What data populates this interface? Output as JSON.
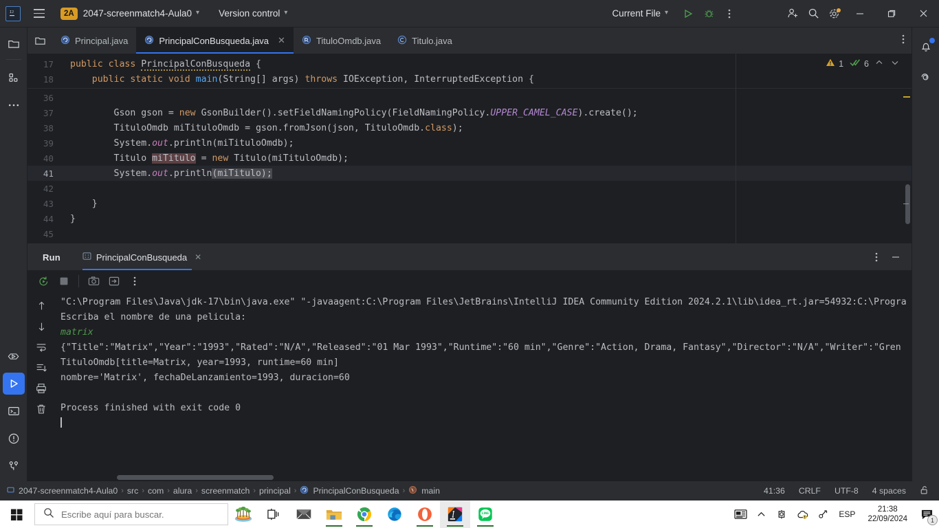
{
  "titlebar": {
    "project_badge": "2A",
    "project_name": "2047-screenmatch4-Aula0",
    "version_control": "Version control",
    "run_config": "Current File",
    "icons": {
      "menu": "hamburger-icon",
      "run": "run-icon",
      "debug": "debug-icon",
      "more": "more-options-icon",
      "account": "account-add-icon",
      "search": "search-icon",
      "settings": "settings-gear-icon",
      "minimize": "minimize-icon",
      "maximize": "maximize-icon",
      "close": "close-icon"
    }
  },
  "left_rail": [
    {
      "name": "project-tool-window",
      "icon": "folder-icon",
      "active": false
    },
    {
      "name": "structure-tool-window",
      "icon": "structure-icon",
      "active": false
    },
    {
      "name": "more-tool-windows",
      "icon": "ellipsis-icon",
      "active": false
    }
  ],
  "left_rail_bottom": [
    {
      "name": "debug-tool-window",
      "icon": "debug-outline-icon",
      "active": false
    },
    {
      "name": "run-tool-window",
      "icon": "run-triangle-icon",
      "active": true
    },
    {
      "name": "terminal-tool-window",
      "icon": "terminal-icon",
      "active": false
    },
    {
      "name": "problems-tool-window",
      "icon": "problems-icon",
      "active": false
    },
    {
      "name": "version-control-tool-window",
      "icon": "branch-icon",
      "active": false
    }
  ],
  "right_rail": [
    {
      "name": "notifications",
      "icon": "bell-icon",
      "badge": true
    },
    {
      "name": "ai-assistant",
      "icon": "spiral-icon",
      "badge": false
    }
  ],
  "tabs": [
    {
      "label": "Principal.java",
      "icon": "java-class-icon",
      "active": false,
      "closable": false
    },
    {
      "label": "PrincipalConBusqueda.java",
      "icon": "java-class-icon",
      "active": true,
      "closable": true
    },
    {
      "label": "TituloOmdb.java",
      "icon": "java-class-record-icon",
      "active": false,
      "closable": false
    },
    {
      "label": "Titulo.java",
      "icon": "java-class-c-icon",
      "active": false,
      "closable": false
    }
  ],
  "editor": {
    "inspection": {
      "warnings": "1",
      "checks": "6"
    },
    "lines": [
      {
        "no": "17",
        "indent": 0,
        "tokens": [
          {
            "t": "public ",
            "c": "kw"
          },
          {
            "t": "class ",
            "c": "kw"
          },
          {
            "t": "PrincipalConBusqueda",
            "c": "squig"
          },
          {
            "t": " {",
            "c": ""
          }
        ]
      },
      {
        "no": "18",
        "indent": 1,
        "tokens": [
          {
            "t": "public ",
            "c": "kw"
          },
          {
            "t": "static ",
            "c": "kw"
          },
          {
            "t": "void ",
            "c": "kw"
          },
          {
            "t": "main",
            "c": "meth"
          },
          {
            "t": "(String[] args) ",
            "c": ""
          },
          {
            "t": "throws ",
            "c": "kw"
          },
          {
            "t": "IOException, InterruptedException {",
            "c": ""
          }
        ]
      },
      {
        "no": "36",
        "indent": 0,
        "tokens": []
      },
      {
        "no": "37",
        "indent": 2,
        "tokens": [
          {
            "t": "Gson gson = ",
            "c": ""
          },
          {
            "t": "new ",
            "c": "kw"
          },
          {
            "t": "GsonBuilder().setFieldNamingPolicy(FieldNamingPolicy.",
            "c": ""
          },
          {
            "t": "UPPER_CAMEL_CASE",
            "c": "const"
          },
          {
            "t": ").create();",
            "c": ""
          }
        ]
      },
      {
        "no": "38",
        "indent": 2,
        "tokens": [
          {
            "t": "TituloOmdb miTituloOmdb = gson.fromJson(json, TituloOmdb.",
            "c": ""
          },
          {
            "t": "class",
            "c": "kw"
          },
          {
            "t": ");",
            "c": ""
          }
        ]
      },
      {
        "no": "39",
        "indent": 2,
        "tokens": [
          {
            "t": "System.",
            "c": ""
          },
          {
            "t": "out",
            "c": "field"
          },
          {
            "t": ".println(miTituloOmdb);",
            "c": ""
          }
        ]
      },
      {
        "no": "40",
        "indent": 2,
        "tokens": [
          {
            "t": "Titulo ",
            "c": ""
          },
          {
            "t": "miTitulo",
            "c": "sel2"
          },
          {
            "t": " = ",
            "c": ""
          },
          {
            "t": "new ",
            "c": "kw"
          },
          {
            "t": "Titulo(miTituloOmdb);",
            "c": ""
          }
        ]
      },
      {
        "no": "41",
        "indent": 2,
        "highlight": true,
        "tokens": [
          {
            "t": "System.",
            "c": ""
          },
          {
            "t": "out",
            "c": "field"
          },
          {
            "t": ".println",
            "c": ""
          },
          {
            "t": "(miTitulo);",
            "c": "sel"
          }
        ]
      },
      {
        "no": "42",
        "indent": 0,
        "tokens": []
      },
      {
        "no": "43",
        "indent": 1,
        "tokens": [
          {
            "t": "}",
            "c": ""
          }
        ]
      },
      {
        "no": "44",
        "indent": 0,
        "tokens": [
          {
            "t": "}",
            "c": ""
          }
        ]
      },
      {
        "no": "45",
        "indent": 0,
        "tokens": []
      }
    ]
  },
  "run_panel": {
    "title": "Run",
    "tab_label": "PrincipalConBusqueda",
    "tab_icon": "run-config-icon",
    "toolbar": [
      {
        "name": "rerun-button",
        "icon": "rerun-icon"
      },
      {
        "name": "stop-button",
        "icon": "stop-square-icon"
      },
      {
        "name": "screenshot-button",
        "icon": "camera-icon"
      },
      {
        "name": "export-button",
        "icon": "export-arrow-icon"
      },
      {
        "name": "more-options-button",
        "icon": "vertical-ellipsis-icon"
      }
    ],
    "side_toolbar": [
      {
        "name": "prev-occurrence-button",
        "icon": "arrow-up-icon"
      },
      {
        "name": "next-occurrence-button",
        "icon": "arrow-down-icon"
      },
      {
        "name": "soft-wrap-button",
        "icon": "soft-wrap-icon"
      },
      {
        "name": "scroll-to-end-button",
        "icon": "scroll-end-icon"
      },
      {
        "name": "print-button",
        "icon": "printer-icon"
      },
      {
        "name": "clear-all-button",
        "icon": "trash-icon"
      }
    ],
    "console": [
      {
        "text": "\"C:\\Program Files\\Java\\jdk-17\\bin\\java.exe\" \"-javaagent:C:\\Program Files\\JetBrains\\IntelliJ IDEA Community Edition 2024.2.1\\lib\\idea_rt.jar=54932:C:\\Progra",
        "kind": "normal"
      },
      {
        "text": "Escriba el nombre de una pelicula:",
        "kind": "normal"
      },
      {
        "text": "matrix",
        "kind": "input"
      },
      {
        "text": "{\"Title\":\"Matrix\",\"Year\":\"1993\",\"Rated\":\"N/A\",\"Released\":\"01 Mar 1993\",\"Runtime\":\"60 min\",\"Genre\":\"Action, Drama, Fantasy\",\"Director\":\"N/A\",\"Writer\":\"Gren",
        "kind": "normal"
      },
      {
        "text": "TituloOmdb[title=Matrix, year=1993, runtime=60 min]",
        "kind": "normal"
      },
      {
        "text": "nombre='Matrix', fechaDeLanzamiento=1993, duracion=60",
        "kind": "normal"
      },
      {
        "text": "",
        "kind": "normal"
      },
      {
        "text": "Process finished with exit code 0",
        "kind": "normal"
      }
    ]
  },
  "status_bar": {
    "breadcrumb": [
      {
        "label": "2047-screenmatch4-Aula0",
        "icon": "module-icon"
      },
      {
        "label": "src",
        "icon": ""
      },
      {
        "label": "com",
        "icon": ""
      },
      {
        "label": "alura",
        "icon": ""
      },
      {
        "label": "screenmatch",
        "icon": ""
      },
      {
        "label": "principal",
        "icon": ""
      },
      {
        "label": "PrincipalConBusqueda",
        "icon": "java-class-icon"
      },
      {
        "label": "main",
        "icon": "method-icon"
      }
    ],
    "caret_position": "41:36",
    "line_separator": "CRLF",
    "encoding": "UTF-8",
    "indent": "4 spaces",
    "lock_icon": "unlocked-icon"
  },
  "taskbar": {
    "search_placeholder": "Escribe aquí para buscar.",
    "search_value": "",
    "apps": [
      {
        "name": "taskview-button",
        "icon": "task-view-icon"
      },
      {
        "name": "mail-app",
        "icon": "mail-icon"
      },
      {
        "name": "file-explorer-app",
        "icon": "folder-explorer-icon"
      },
      {
        "name": "chrome-app",
        "icon": "chrome-icon"
      },
      {
        "name": "edge-app",
        "icon": "edge-icon"
      },
      {
        "name": "opera-app",
        "icon": "opera-icon"
      },
      {
        "name": "intellij-app",
        "icon": "intellij-icon"
      },
      {
        "name": "line-app",
        "icon": "line-icon"
      }
    ],
    "tray": {
      "news_icon": "news-weather-icon",
      "expand_icon": "show-hidden-icons-icon",
      "onedrive_icon": "onedrive-icon",
      "cloud_icon": "cloud-warning-icon",
      "network_icon": "network-icon",
      "language": "ESP",
      "time": "21:38",
      "date": "22/09/2024",
      "notification_count": "1"
    }
  },
  "colors": {
    "accent": "#3574f0",
    "badge": "#d99b24",
    "bg_editor": "#1e1f22",
    "bg_chrome": "#2b2d30",
    "console_input": "#4c9a4c"
  }
}
